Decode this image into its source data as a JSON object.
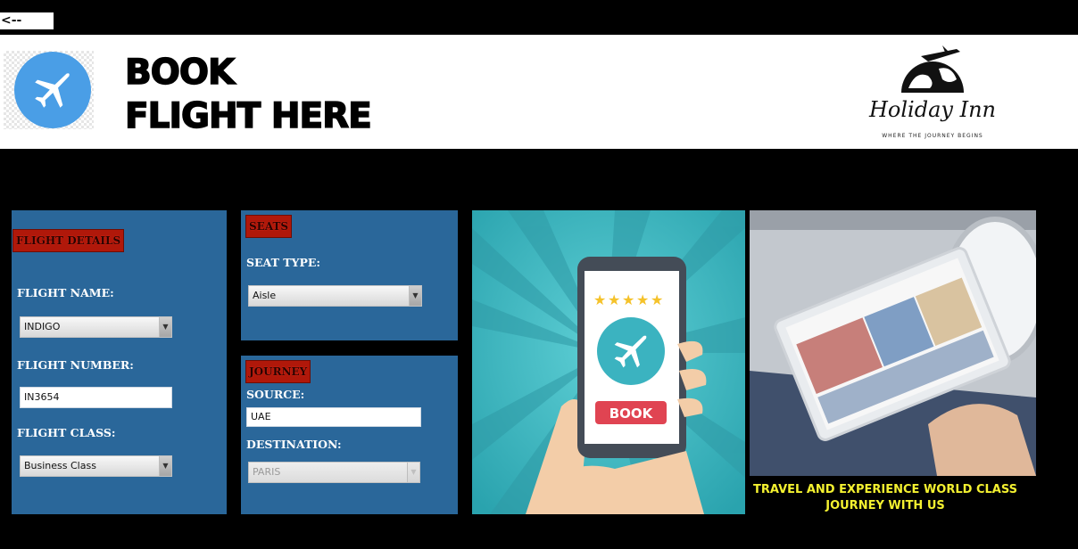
{
  "nav": {
    "back_label": "<--Back"
  },
  "header": {
    "title_line1": "BOOK",
    "title_line2": "FLIGHT HERE",
    "app_icon": "airplane-icon",
    "brand_name": "Holiday Inn",
    "brand_tagline": "WHERE THE JOURNEY BEGINS"
  },
  "flight_details": {
    "section_label": "FLIGHT DETAILS",
    "name_label": "FLIGHT NAME:",
    "name_value": "INDIGO",
    "number_label": "FLIGHT NUMBER:",
    "number_value": "IN3654",
    "class_label": "FLIGHT CLASS:",
    "class_value": "Business Class"
  },
  "seats": {
    "section_label": "SEATS",
    "seat_type_label": "SEAT TYPE:",
    "seat_type_value": "Aisle"
  },
  "journey": {
    "section_label": "JOURNEY",
    "source_label": "SOURCE:",
    "source_value": "UAE",
    "destination_label": "DESTINATION:",
    "destination_value": "PARIS"
  },
  "promo": {
    "book_button_label": "BOOK",
    "rating_stars": 5,
    "caption_line1": "TRAVEL AND EXPERIENCE WORLD CLASS",
    "caption_line2": "JOURNEY WITH US"
  },
  "colors": {
    "panel_bg": "#2a679a",
    "section_tag_bg": "#b0180a",
    "caption_text": "#f4f130",
    "page_bg": "#000000"
  }
}
